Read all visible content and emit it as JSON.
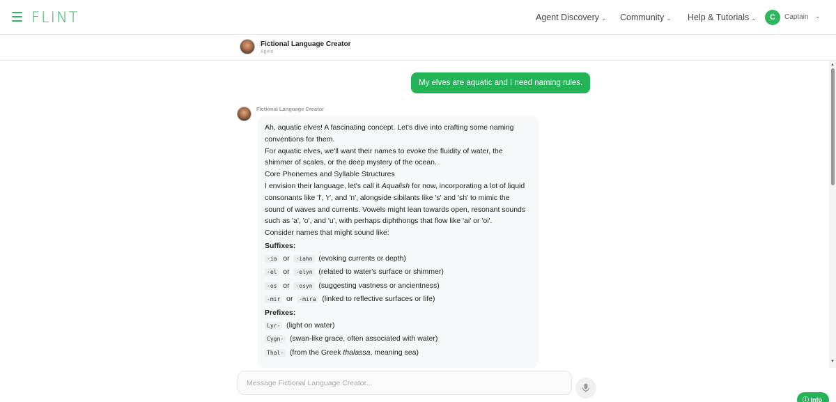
{
  "app": {
    "brand": "FLINT"
  },
  "nav": {
    "items": [
      {
        "label": "Agent Discovery"
      },
      {
        "label": "Community"
      },
      {
        "label": "Help & Tutorials"
      }
    ],
    "user": {
      "initial": "C",
      "name": "Captain"
    }
  },
  "agent": {
    "name": "Fictional Language Creator",
    "role": "Agent"
  },
  "chat": {
    "user_message": "My elves are aquatic and I need naming rules.",
    "bot_name": "Fictional Language Creator",
    "response": {
      "intro": "Ah, aquatic elves! A fascinating concept. Let's dive into crafting some naming conventions for them.",
      "para2": "For aquatic elves, we'll want their names to evoke the fluidity of water, the shimmer of scales, or the deep mystery of the ocean.",
      "section_heading": "Core Phonemes and Syllable Structures",
      "para3_before": "I envision their language, let's call it ",
      "para3_italic": "Aqualish",
      "para3_after": " for now, incorporating a lot of liquid consonants like 'l', 'r', and 'n', alongside sibilants like 's' and 'sh' to mimic the sound of waves and currents. Vowels might lean towards open, resonant sounds such as 'a', 'o', and 'u', with perhaps diphthongs that flow like 'ai' or 'oi'.",
      "para4": "Consider names that might sound like:",
      "suffixes_heading": "Suffixes:",
      "or_word": "or",
      "suffixes": [
        {
          "a": "-ia",
          "b": "-iahn",
          "desc": "(evoking currents or depth)"
        },
        {
          "a": "-el",
          "b": "-elyn",
          "desc": "(related to water's surface or shimmer)"
        },
        {
          "a": "-os",
          "b": "-osyn",
          "desc": "(suggesting vastness or ancientness)"
        },
        {
          "a": "-mir",
          "b": "-mira",
          "desc": "(linked to reflective surfaces or life)"
        }
      ],
      "prefixes_heading": "Prefixes:",
      "prefixes": [
        {
          "code": "Lyr-",
          "desc": "(light on water)"
        },
        {
          "code": "Cygn-",
          "desc": "(swan-like grace, often associated with water)"
        },
        {
          "code": "Thal-",
          "desc_before": "(from the Greek ",
          "desc_italic": "thalassa",
          "desc_after": ", meaning sea)"
        }
      ]
    }
  },
  "composer": {
    "placeholder": "Message Fictional Language Creator..."
  },
  "info_button": {
    "label": "Info"
  },
  "icons": [
    "menu-icon",
    "chevron-down-icon",
    "microphone-icon",
    "scroll-up-arrow-icon",
    "scroll-down-arrow-icon",
    "info-icon"
  ],
  "colors": {
    "accent": "#22b456",
    "brand": "#2eb85c",
    "bubble_bg": "#f6f8fa"
  }
}
